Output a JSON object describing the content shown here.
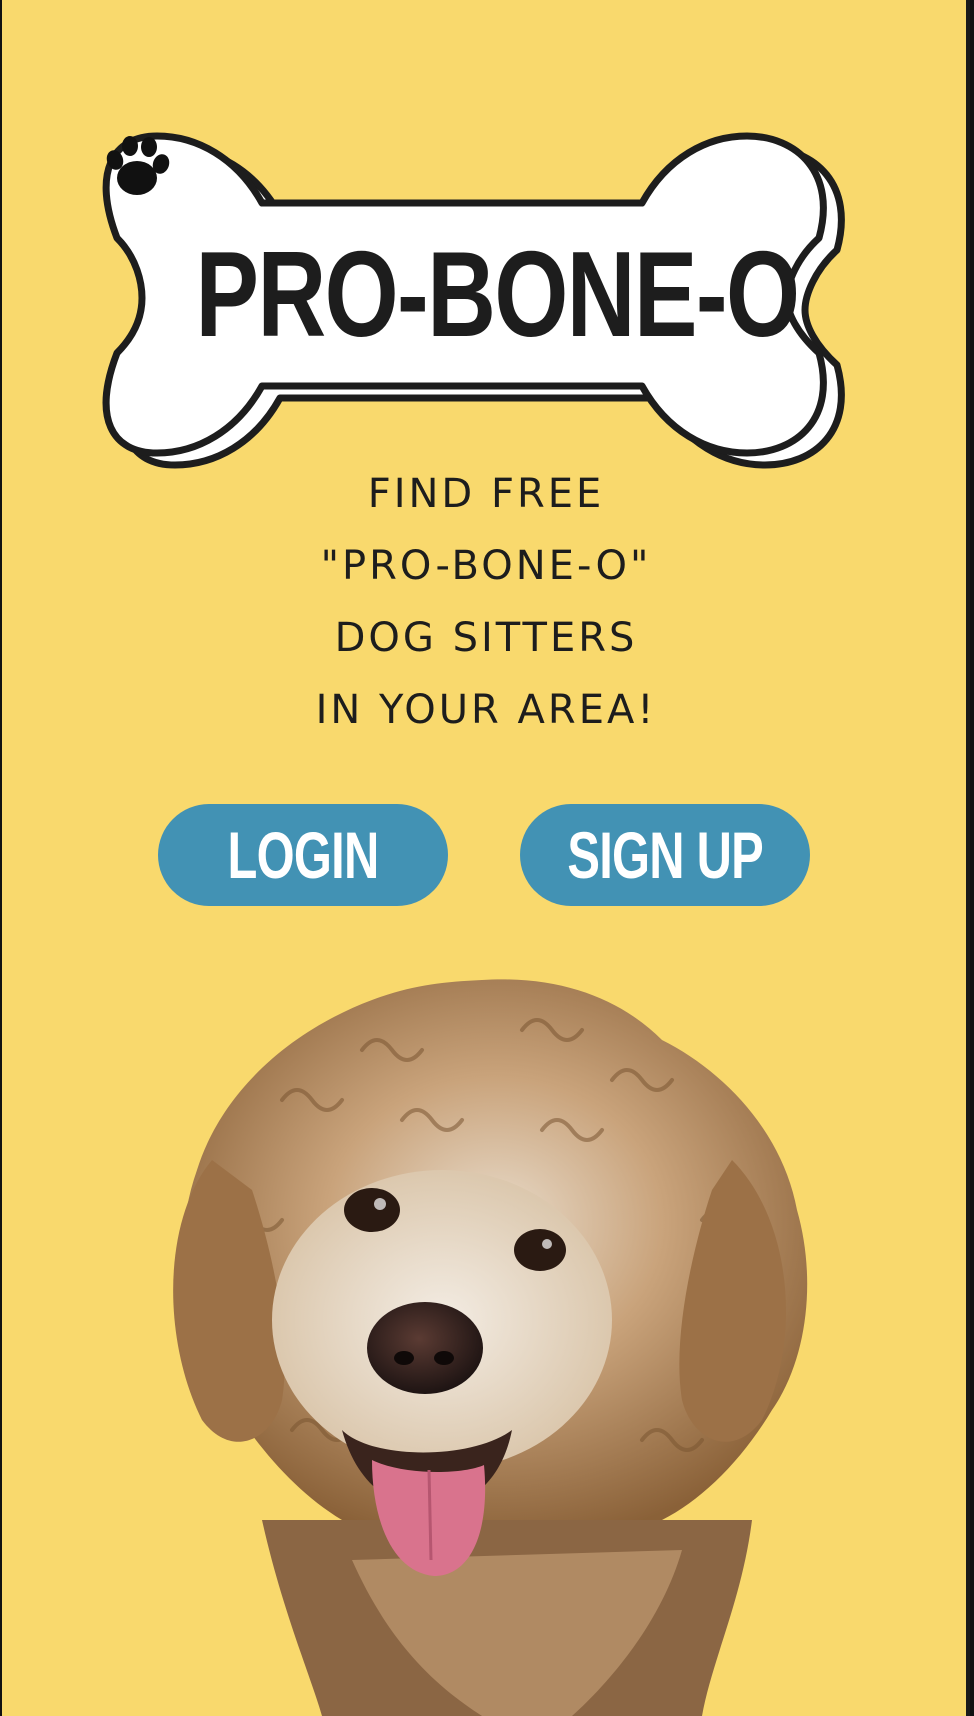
{
  "app": {
    "brand": "PRO-BONE-O"
  },
  "tagline": {
    "lines": [
      "FIND FREE",
      "\"PRO-BONE-O\"",
      "DOG SITTERS",
      "IN YOUR AREA!"
    ]
  },
  "actions": {
    "login_label": "LOGIN",
    "signup_label": "SIGN UP"
  },
  "icons": {
    "logo": "bone-icon",
    "paw": "paw-icon",
    "hero": "dog-photo"
  },
  "colors": {
    "background": "#f9d96d",
    "button": "#4292b4",
    "button_text": "#ffffff",
    "text": "#1d1d1d",
    "bone_fill": "#ffffff",
    "bone_outline": "#1d1d1d"
  }
}
